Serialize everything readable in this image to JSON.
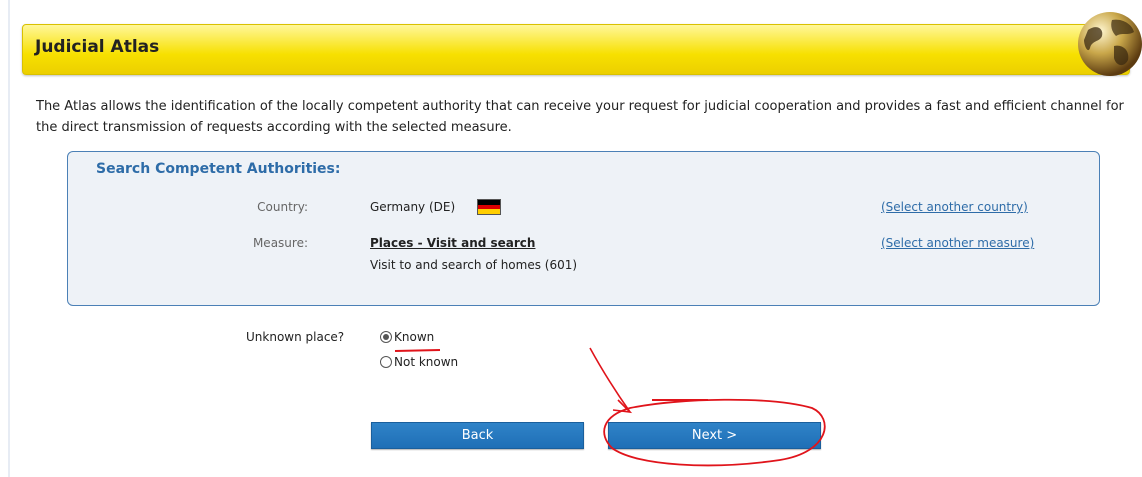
{
  "header": {
    "title": "Judicial Atlas"
  },
  "intro": "The Atlas allows the identification of the locally competent authority that can receive your request for judicial cooperation and provides a fast and efficient channel for the direct transmission of requests according with the selected measure.",
  "search": {
    "title": "Search Competent Authorities:",
    "country_label": "Country:",
    "country_value": "Germany (DE)",
    "country_flag_colors": [
      "#000000",
      "#dd0000",
      "#ffce00"
    ],
    "select_country": "(Select another country)",
    "measure_label": "Measure:",
    "measure_value": "Places - Visit and search",
    "measure_detail": "Visit to and search of homes (601)",
    "select_measure": "(Select another measure)"
  },
  "place": {
    "question": "Unknown place?",
    "options": [
      {
        "label": "Known",
        "checked": true
      },
      {
        "label": "Not known",
        "checked": false
      }
    ]
  },
  "buttons": {
    "back": "Back",
    "next": "Next >"
  },
  "colors": {
    "accent": "#2e6ca8",
    "button": "#2479bf",
    "header": "#f7e000",
    "annotation": "#e0141b"
  }
}
